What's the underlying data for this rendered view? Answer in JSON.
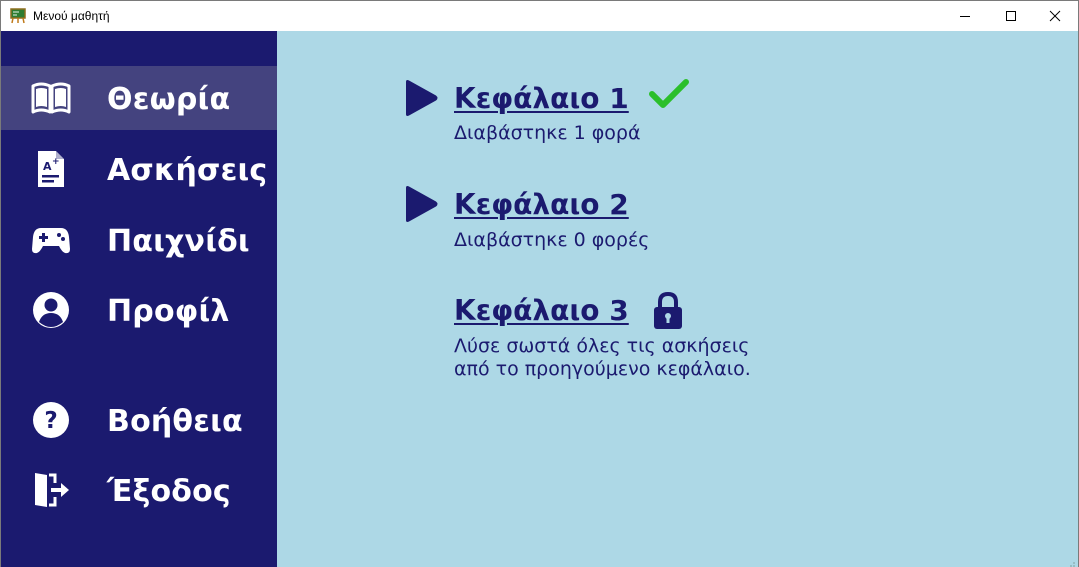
{
  "window": {
    "title": "Μενού μαθητή"
  },
  "sidebar": {
    "items": [
      {
        "label": "Θεωρία",
        "icon": "book-open-icon",
        "active": true
      },
      {
        "label": "Ασκήσεις",
        "icon": "graded-paper-icon",
        "active": false
      },
      {
        "label": "Παιχνίδι",
        "icon": "gamepad-icon",
        "active": false
      },
      {
        "label": "Προφίλ",
        "icon": "user-circle-icon",
        "active": false
      },
      {
        "label": "Βοήθεια",
        "icon": "question-circle-icon",
        "active": false
      },
      {
        "label": "Έξοδος",
        "icon": "exit-door-icon",
        "active": false
      }
    ]
  },
  "main": {
    "chapters": [
      {
        "title": "Κεφάλαιο 1",
        "subtitle": "Διαβάστηκε 1 φορά",
        "status": "completed"
      },
      {
        "title": "Κεφάλαιο 2",
        "subtitle": "Διαβάστηκε 0 φορές",
        "status": "available"
      },
      {
        "title": "Κεφάλαιο 3",
        "subtitle_lines": [
          "Λύσε σωστά όλες τις ασκήσεις",
          "από το προηγούμενο κεφάλαιο."
        ],
        "status": "locked"
      }
    ]
  },
  "colors": {
    "sidebar_bg": "#1b1a6f",
    "sidebar_active": "#44437f",
    "main_bg": "#add8e6",
    "accent": "#1b1a6f",
    "check": "#2bbf2b"
  }
}
